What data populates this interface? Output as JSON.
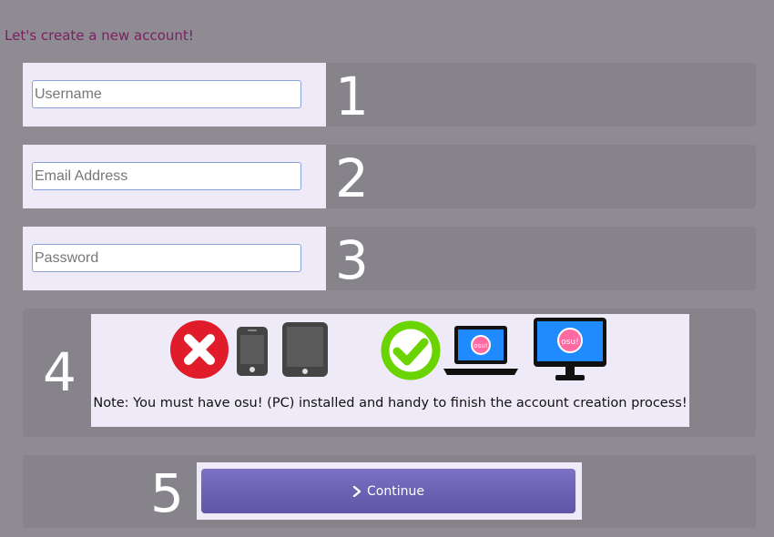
{
  "page": {
    "heading": "Let's create a new account!"
  },
  "steps": {
    "username": {
      "number": "1",
      "placeholder": "Username"
    },
    "email": {
      "number": "2",
      "placeholder": "Email Address"
    },
    "password": {
      "number": "3",
      "placeholder": "Password"
    },
    "requirements": {
      "number": "4",
      "note": "Note: You must have osu! (PC) installed and handy to finish the account creation process!",
      "unsupported_devices": [
        "x-mark-icon",
        "phone-icon",
        "tablet-icon"
      ],
      "supported_devices": [
        "check-mark-icon",
        "laptop-icon",
        "desktop-icon"
      ],
      "device_logo_text": "osu!"
    },
    "continue": {
      "number": "5",
      "label": "Continue",
      "icon": "chevron-right-icon"
    }
  },
  "colors": {
    "background": "#8e8b93",
    "heading": "#7b2060",
    "panel": "#efeaf8",
    "button": "#6a60b5",
    "reject": "#e01b2a",
    "accept": "#6ad400"
  }
}
